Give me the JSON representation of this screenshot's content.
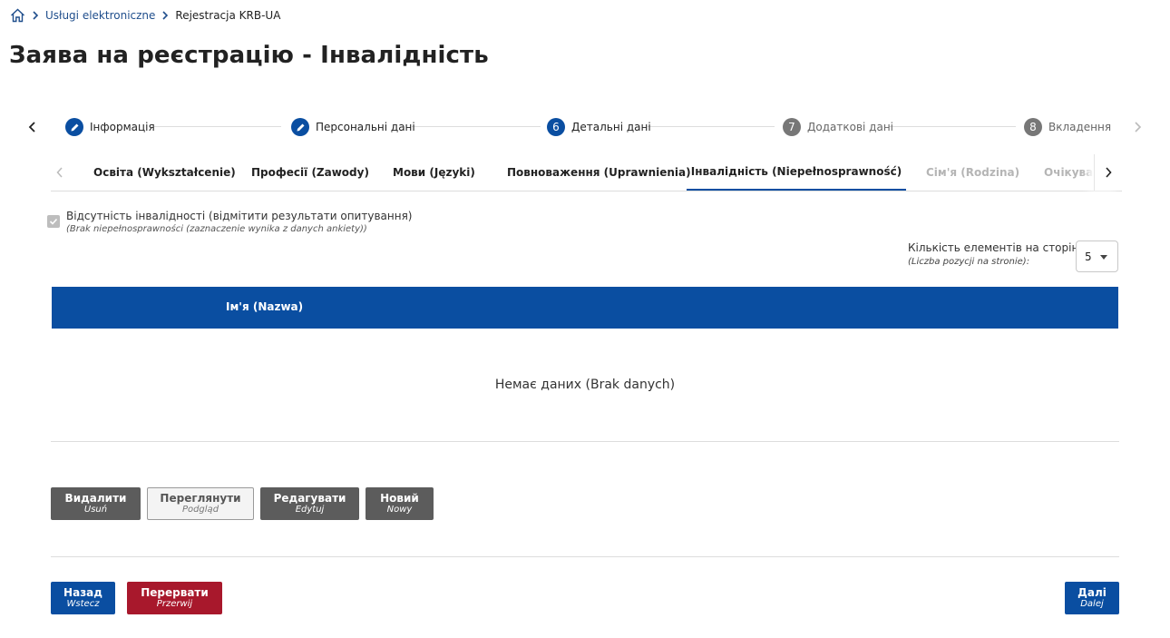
{
  "breadcrumb": {
    "items": [
      "Usługi elektroniczne",
      "Rejestracja KRB-UA"
    ]
  },
  "page": {
    "title": "Заява на реєстрацію - Інвалідність"
  },
  "stepper": {
    "steps": [
      {
        "label": "Інформація",
        "state": "done",
        "icon": "pencil-icon"
      },
      {
        "label": "Персональні дані",
        "state": "done",
        "icon": "pencil-icon"
      },
      {
        "label": "Детальні дані",
        "state": "active",
        "number": "6"
      },
      {
        "label": "Додаткові дані",
        "state": "todo",
        "number": "7"
      },
      {
        "label": "Вкладення",
        "state": "todo",
        "number": "8"
      }
    ]
  },
  "tabs": {
    "items": [
      {
        "label": "Освіта (Wykształcenie)",
        "state": "normal"
      },
      {
        "label": "Професії (Zawody)",
        "state": "normal"
      },
      {
        "label": "Мови (Języki)",
        "state": "normal"
      },
      {
        "label": "Повноваження (Uprawnienia)",
        "state": "normal"
      },
      {
        "label": "Інвалідність (Niepełnosprawność)",
        "state": "active"
      },
      {
        "label": "Сім'я (Rodzina)",
        "state": "disabled"
      },
      {
        "label": "Очікування (Oczekiwania)",
        "state": "disabled"
      }
    ]
  },
  "checkbox": {
    "label": "Відсутність інвалідності (відмітити результати опитування)",
    "sublabel": "(Brak niepełnosprawności (zaznaczenie wynika z danych ankiety))",
    "checked": true
  },
  "page_size": {
    "label": "Кількість елементів на сторінці",
    "sublabel": "(Liczba pozycji na stronie):",
    "value": "5"
  },
  "table": {
    "columns": [
      "Ім'я (Nazwa)"
    ],
    "empty_text": "Немає даних (Brak danych)"
  },
  "actions": {
    "delete": {
      "label": "Видалити",
      "sublabel": "Usuń"
    },
    "view": {
      "label": "Переглянути",
      "sublabel": "Podgląd"
    },
    "edit": {
      "label": "Редагувати",
      "sublabel": "Edytuj"
    },
    "new": {
      "label": "Новий",
      "sublabel": "Nowy"
    }
  },
  "navigation": {
    "back": {
      "label": "Назад",
      "sublabel": "Wstecz"
    },
    "abort": {
      "label": "Перервати",
      "sublabel": "Przerwij"
    },
    "next": {
      "label": "Далі",
      "sublabel": "Dalej"
    }
  },
  "colors": {
    "primary": "#0a4ea1",
    "danger": "#a8182c",
    "gray_button": "#5c5c5c",
    "todo_step": "#777777"
  }
}
